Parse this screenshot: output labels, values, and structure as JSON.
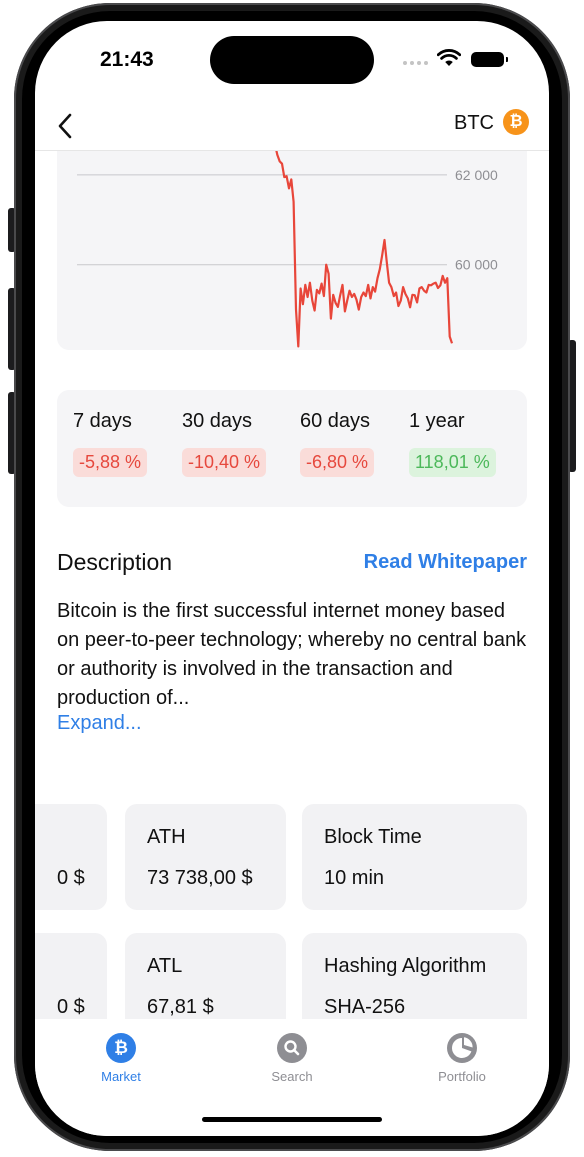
{
  "status_bar": {
    "time": "21:43"
  },
  "nav": {
    "coin_symbol": "BTC",
    "coin_logo_glyph": "₿",
    "back_icon": "chevron-left-icon"
  },
  "chart_data": {
    "type": "line",
    "color": "#e8463a",
    "tick_labels": [
      "62 000",
      "60 000"
    ],
    "y_ticks": [
      62000,
      60000
    ],
    "ylim": [
      58100,
      63000
    ],
    "x": [
      0,
      1,
      2,
      3,
      4,
      5,
      6,
      7,
      8,
      9,
      10,
      11,
      12,
      13,
      14,
      15,
      16,
      17,
      18,
      19,
      20,
      21,
      22,
      23,
      24,
      25,
      26,
      27,
      28,
      29,
      30,
      31,
      32,
      33,
      34,
      35,
      36,
      37,
      38,
      39,
      40,
      41,
      42,
      43,
      44,
      45,
      46,
      47,
      48,
      49,
      50,
      51,
      52,
      53,
      54,
      55,
      56,
      57,
      58,
      59,
      60,
      61,
      62,
      63,
      64,
      65,
      66,
      67,
      68,
      69,
      70,
      71,
      72,
      73,
      74,
      75,
      76
    ],
    "y": [
      62680,
      62450,
      62300,
      62250,
      61950,
      61970,
      61700,
      61900,
      61400,
      59000,
      58180,
      59470,
      59120,
      59550,
      59280,
      59600,
      59200,
      58980,
      59440,
      59360,
      59580,
      59300,
      60000,
      59800,
      58800,
      59330,
      59150,
      59060,
      59320,
      59550,
      58960,
      59200,
      59420,
      59280,
      59350,
      59220,
      59000,
      59280,
      59380,
      59300,
      59550,
      59250,
      59500,
      59400,
      59700,
      59900,
      60200,
      60550,
      60050,
      59600,
      59500,
      59300,
      59380,
      59080,
      59200,
      59500,
      59350,
      59250,
      59050,
      59330,
      59320,
      59160,
      59470,
      59500,
      59420,
      59380,
      59550,
      59540,
      59580,
      59600,
      59480,
      59540,
      59750,
      59600,
      59700,
      58400,
      58250
    ]
  },
  "performance": [
    {
      "label": "7 days",
      "value": "-5,88 %",
      "trend": "negative"
    },
    {
      "label": "30 days",
      "value": "-10,40 %",
      "trend": "negative"
    },
    {
      "label": "60 days",
      "value": "-6,80 %",
      "trend": "negative"
    },
    {
      "label": "1 year",
      "value": "118,01 %",
      "trend": "positive"
    }
  ],
  "description": {
    "title": "Description",
    "whitepaper_link": "Read Whitepaper",
    "text": "Bitcoin is the first successful internet money based on peer-to-peer technology; whereby no central bank or authority is involved in the transaction and production of...",
    "expand_label": "Expand..."
  },
  "stats": [
    {
      "label": "",
      "value": "0 $"
    },
    {
      "label": "ATH",
      "value": "73 738,00 $"
    },
    {
      "label": "Block Time",
      "value": "10 min"
    },
    {
      "label": "",
      "value": "0 $"
    },
    {
      "label": "ATL",
      "value": "67,81 $"
    },
    {
      "label": "Hashing Algorithm",
      "value": "SHA-256"
    }
  ],
  "tabs": [
    {
      "label": "Market",
      "icon": "bitcoin-icon",
      "glyph": "₿",
      "active": true
    },
    {
      "label": "Search",
      "icon": "search-icon",
      "active": false
    },
    {
      "label": "Portfolio",
      "icon": "pie-chart-icon",
      "active": false
    }
  ],
  "colors": {
    "accent": "#2f7fe6",
    "negative": "#e6483d",
    "positive": "#4cb85a",
    "bitcoin": "#f7931a"
  }
}
